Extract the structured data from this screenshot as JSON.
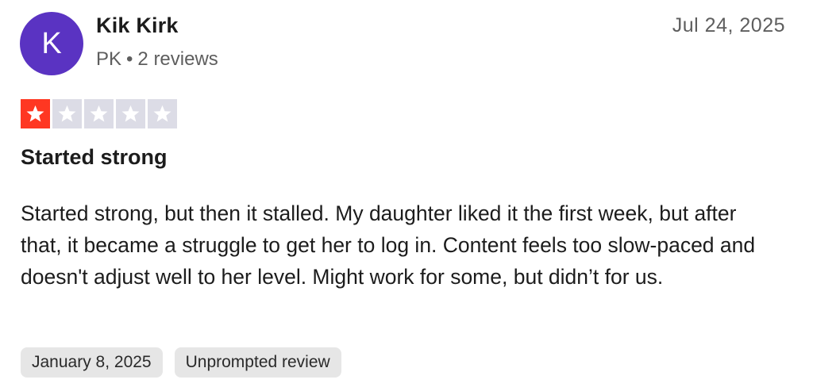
{
  "reviewer": {
    "initial": "K",
    "name": "Kik Kirk",
    "country": "PK",
    "separator": "•",
    "review_count": "2 reviews",
    "avatar_color": "#5a33c2"
  },
  "review": {
    "date": "Jul 24, 2025",
    "rating": 1,
    "max_rating": 5,
    "star_color_filled": "#ff3722",
    "star_color_empty": "#dcdce6",
    "title": "Started strong",
    "body": "Started strong, but then it stalled. My daughter liked it the first week, but after that, it became a struggle to get her to log in. Content feels too slow-paced and doesn't adjust well to her level. Might work for some, but didn’t for us.",
    "experience_date": "January 8, 2025",
    "tag": "Unprompted review"
  }
}
